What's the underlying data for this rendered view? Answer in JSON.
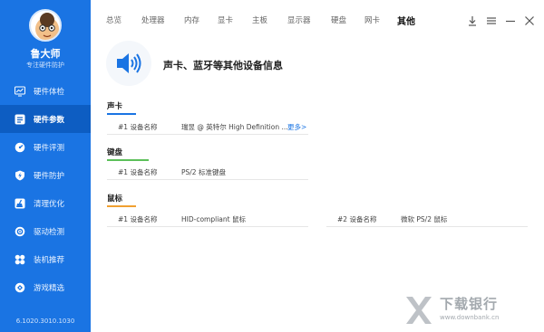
{
  "sidebar": {
    "brand": "鲁大师",
    "subtitle": "专注硬件防护",
    "items": [
      {
        "label": "硬件体检",
        "icon": "monitor-chart-icon"
      },
      {
        "label": "硬件参数",
        "icon": "list-icon"
      },
      {
        "label": "硬件评测",
        "icon": "gauge-icon"
      },
      {
        "label": "硬件防护",
        "icon": "shield-bolt-icon"
      },
      {
        "label": "清理优化",
        "icon": "broom-icon"
      },
      {
        "label": "驱动检测",
        "icon": "gear-circle-icon"
      },
      {
        "label": "装机推荐",
        "icon": "fan-icon"
      },
      {
        "label": "游戏精选",
        "icon": "game-icon"
      }
    ],
    "active_index": 1,
    "version": "6.1020.3010.1030"
  },
  "tabs": [
    "总览",
    "处理器",
    "内存",
    "显卡",
    "主板",
    "显示器",
    "硬盘",
    "网卡",
    "其他"
  ],
  "active_tab": "其他",
  "header": {
    "title": "声卡、蓝牙等其他设备信息",
    "icon": "speaker-icon"
  },
  "sections": {
    "sound": {
      "title": "声卡",
      "rows": [
        {
          "label": "#1 设备名称",
          "value": "瑞昱 @ 英特尔 High Definition ...",
          "more": "更多>"
        }
      ]
    },
    "keyboard": {
      "title": "键盘",
      "rows": [
        {
          "label": "#1 设备名称",
          "value": "PS/2 标准键盘"
        }
      ]
    },
    "mouse": {
      "title": "鼠标",
      "rows": [
        {
          "label": "#1 设备名称",
          "value": "HID-compliant 鼠标"
        },
        {
          "label": "#2 设备名称",
          "value": "微软 PS/2 鼠标"
        }
      ]
    }
  },
  "colors": {
    "sidebar": "#1a74e3",
    "sidebar_active": "#0d5dc2",
    "sound_accent": "#1a74e3",
    "keyboard_accent": "#5cc05a",
    "mouse_accent": "#f0a030"
  },
  "watermark": {
    "big": "下载银行",
    "small": "www.downbank.cn"
  }
}
